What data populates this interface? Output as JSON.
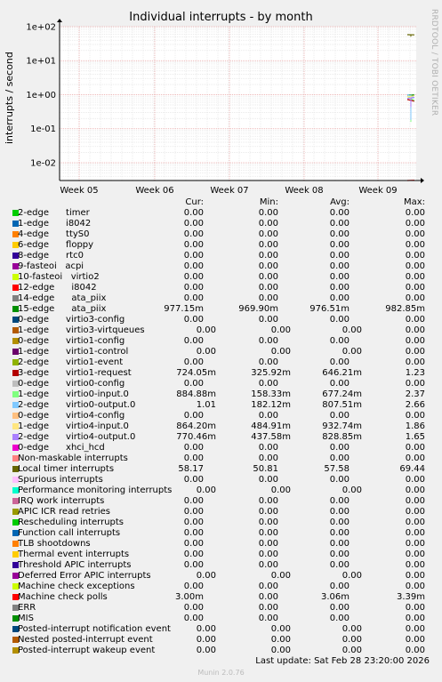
{
  "chart_data": {
    "type": "line",
    "title": "Individual interrupts - by month",
    "ylabel": "interrupts / second",
    "yscale": "log",
    "ylim": [
      0.003,
      100
    ],
    "y_ticks": [
      "1e-02",
      "1e-01",
      "1e+00",
      "1e+01",
      "1e+02"
    ],
    "x_ticks": [
      "Week 05",
      "Week 06",
      "Week 07",
      "Week 08",
      "Week 09"
    ],
    "grid": true,
    "columns": [
      "Cur:",
      "Min:",
      "Avg:",
      "Max:"
    ],
    "series": [
      {
        "name": "2-edge      timer",
        "color": "#00cc00",
        "cur": "0.00",
        "min": "0.00",
        "avg": "0.00",
        "max": "0.00"
      },
      {
        "name": "1-edge      i8042",
        "color": "#0066b3",
        "cur": "0.00",
        "min": "0.00",
        "avg": "0.00",
        "max": "0.00"
      },
      {
        "name": "4-edge      ttyS0",
        "color": "#ff8000",
        "cur": "0.00",
        "min": "0.00",
        "avg": "0.00",
        "max": "0.00"
      },
      {
        "name": "6-edge      floppy",
        "color": "#ffcc00",
        "cur": "0.00",
        "min": "0.00",
        "avg": "0.00",
        "max": "0.00"
      },
      {
        "name": "8-edge      rtc0",
        "color": "#330099",
        "cur": "0.00",
        "min": "0.00",
        "avg": "0.00",
        "max": "0.00"
      },
      {
        "name": "9-fasteoi   acpi",
        "color": "#990099",
        "cur": "0.00",
        "min": "0.00",
        "avg": "0.00",
        "max": "0.00"
      },
      {
        "name": "10-fasteoi   virtio2",
        "color": "#ccff00",
        "cur": "0.00",
        "min": "0.00",
        "avg": "0.00",
        "max": "0.00"
      },
      {
        "name": "12-edge      i8042",
        "color": "#ff0000",
        "cur": "0.00",
        "min": "0.00",
        "avg": "0.00",
        "max": "0.00"
      },
      {
        "name": "14-edge      ata_piix",
        "color": "#808080",
        "cur": "0.00",
        "min": "0.00",
        "avg": "0.00",
        "max": "0.00"
      },
      {
        "name": "15-edge      ata_piix",
        "color": "#008f00",
        "cur": "977.15m",
        "min": "969.90m",
        "avg": "976.51m",
        "max": "982.85m"
      },
      {
        "name": "0-edge      virtio3-config",
        "color": "#00487d",
        "cur": "0.00",
        "min": "0.00",
        "avg": "0.00",
        "max": "0.00"
      },
      {
        "name": "1-edge      virtio3-virtqueues",
        "color": "#b35a00",
        "cur": "0.00",
        "min": "0.00",
        "avg": "0.00",
        "max": "0.00"
      },
      {
        "name": "0-edge      virtio1-config",
        "color": "#b38f00",
        "cur": "0.00",
        "min": "0.00",
        "avg": "0.00",
        "max": "0.00"
      },
      {
        "name": "1-edge      virtio1-control",
        "color": "#6b006b",
        "cur": "0.00",
        "min": "0.00",
        "avg": "0.00",
        "max": "0.00"
      },
      {
        "name": "2-edge      virtio1-event",
        "color": "#8fb300",
        "cur": "0.00",
        "min": "0.00",
        "avg": "0.00",
        "max": "0.00"
      },
      {
        "name": "3-edge      virtio1-request",
        "color": "#b30000",
        "cur": "724.05m",
        "min": "325.92m",
        "avg": "646.21m",
        "max": "1.23"
      },
      {
        "name": "0-edge      virtio0-config",
        "color": "#bebebe",
        "cur": "0.00",
        "min": "0.00",
        "avg": "0.00",
        "max": "0.00"
      },
      {
        "name": "1-edge      virtio0-input.0",
        "color": "#80ff80",
        "cur": "884.88m",
        "min": "158.33m",
        "avg": "677.24m",
        "max": "2.37"
      },
      {
        "name": "2-edge      virtio0-output.0",
        "color": "#80c9ff",
        "cur": "1.01",
        "min": "182.12m",
        "avg": "807.51m",
        "max": "2.66"
      },
      {
        "name": "0-edge      virtio4-config",
        "color": "#ffc080",
        "cur": "0.00",
        "min": "0.00",
        "avg": "0.00",
        "max": "0.00"
      },
      {
        "name": "1-edge      virtio4-input.0",
        "color": "#ffe680",
        "cur": "864.20m",
        "min": "484.91m",
        "avg": "932.74m",
        "max": "1.86"
      },
      {
        "name": "2-edge      virtio4-output.0",
        "color": "#aa80ff",
        "cur": "770.46m",
        "min": "437.58m",
        "avg": "828.85m",
        "max": "1.65"
      },
      {
        "name": "0-edge      xhci_hcd",
        "color": "#ee00cc",
        "cur": "0.00",
        "min": "0.00",
        "avg": "0.00",
        "max": "0.00"
      },
      {
        "name": "Non-maskable interrupts",
        "color": "#ff8080",
        "cur": "0.00",
        "min": "0.00",
        "avg": "0.00",
        "max": "0.00"
      },
      {
        "name": "Local timer interrupts",
        "color": "#666600",
        "cur": "58.17",
        "min": "50.81",
        "avg": "57.58",
        "max": "69.44"
      },
      {
        "name": "Spurious interrupts",
        "color": "#ffbfff",
        "cur": "0.00",
        "min": "0.00",
        "avg": "0.00",
        "max": "0.00"
      },
      {
        "name": "Performance monitoring interrupts",
        "color": "#00ffcc",
        "cur": "0.00",
        "min": "0.00",
        "avg": "0.00",
        "max": "0.00"
      },
      {
        "name": "IRQ work interrupts",
        "color": "#cc6699",
        "cur": "0.00",
        "min": "0.00",
        "avg": "0.00",
        "max": "0.00"
      },
      {
        "name": "APIC ICR read retries",
        "color": "#999900",
        "cur": "0.00",
        "min": "0.00",
        "avg": "0.00",
        "max": "0.00"
      },
      {
        "name": "Rescheduling interrupts",
        "color": "#00cc00",
        "cur": "0.00",
        "min": "0.00",
        "avg": "0.00",
        "max": "0.00"
      },
      {
        "name": "Function call interrupts",
        "color": "#0066b3",
        "cur": "0.00",
        "min": "0.00",
        "avg": "0.00",
        "max": "0.00"
      },
      {
        "name": "TLB shootdowns",
        "color": "#ff8000",
        "cur": "0.00",
        "min": "0.00",
        "avg": "0.00",
        "max": "0.00"
      },
      {
        "name": "Thermal event interrupts",
        "color": "#ffcc00",
        "cur": "0.00",
        "min": "0.00",
        "avg": "0.00",
        "max": "0.00"
      },
      {
        "name": "Threshold APIC interrupts",
        "color": "#330099",
        "cur": "0.00",
        "min": "0.00",
        "avg": "0.00",
        "max": "0.00"
      },
      {
        "name": "Deferred Error APIC interrupts",
        "color": "#990099",
        "cur": "0.00",
        "min": "0.00",
        "avg": "0.00",
        "max": "0.00"
      },
      {
        "name": "Machine check exceptions",
        "color": "#ccff00",
        "cur": "0.00",
        "min": "0.00",
        "avg": "0.00",
        "max": "0.00"
      },
      {
        "name": "Machine check polls",
        "color": "#ff0000",
        "cur": "3.00m",
        "min": "0.00",
        "avg": "3.06m",
        "max": "3.39m"
      },
      {
        "name": "ERR",
        "color": "#808080",
        "cur": "0.00",
        "min": "0.00",
        "avg": "0.00",
        "max": "0.00"
      },
      {
        "name": "MIS",
        "color": "#008f00",
        "cur": "0.00",
        "min": "0.00",
        "avg": "0.00",
        "max": "0.00"
      },
      {
        "name": "Posted-interrupt notification event",
        "color": "#00487d",
        "cur": "0.00",
        "min": "0.00",
        "avg": "0.00",
        "max": "0.00"
      },
      {
        "name": "Nested posted-interrupt event",
        "color": "#b35a00",
        "cur": "0.00",
        "min": "0.00",
        "avg": "0.00",
        "max": "0.00"
      },
      {
        "name": "Posted-interrupt wakeup event",
        "color": "#b38f00",
        "cur": "0.00",
        "min": "0.00",
        "avg": "0.00",
        "max": "0.00"
      }
    ],
    "last_update": "Last update:  Sat Feb 28 23:20:00 2026",
    "watermark": "RRDTOOL / TOBI OETIKER",
    "footer": "Munin 2.0.76"
  }
}
